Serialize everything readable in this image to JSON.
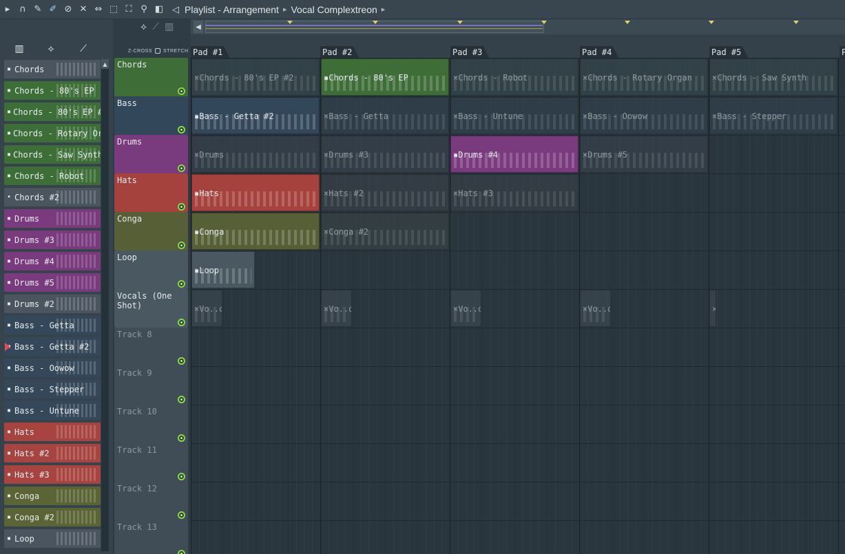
{
  "toolbar": {
    "icons": [
      "play-arrow-icon",
      "magnet-icon",
      "pencil-icon",
      "brush-icon",
      "delete-icon",
      "mute-icon",
      "slip-icon",
      "select-icon",
      "zoom-icon",
      "playback-icon"
    ],
    "breadcrumb": [
      "Playlist - Arrangement",
      "Vocal Complextreon"
    ]
  },
  "browser": {
    "tabs": [
      "piano-icon",
      "wave-icon",
      "automation-icon"
    ],
    "patterns": [
      {
        "label": "Chords",
        "color": "#4a5560",
        "icon": "▪"
      },
      {
        "label": "Chords - 80's EP",
        "color": "#3d6e37",
        "icon": "▪"
      },
      {
        "label": "Chords - 80's EP #2",
        "color": "#3d6e37",
        "icon": "▪"
      },
      {
        "label": "Chords - Rotary Organ",
        "color": "#3d6e37",
        "icon": "▪"
      },
      {
        "label": "Chords - Saw Synth",
        "color": "#3d6e37",
        "icon": "▪"
      },
      {
        "label": "Chords - Robot",
        "color": "#3d6e37",
        "icon": "▪"
      },
      {
        "label": "Chords #2",
        "color": "#4a5560",
        "icon": "•"
      },
      {
        "label": "Drums",
        "color": "#7a3a7e",
        "icon": "▪"
      },
      {
        "label": "Drums #3",
        "color": "#7a3a7e",
        "icon": "▪"
      },
      {
        "label": "Drums #4",
        "color": "#7a3a7e",
        "icon": "▪"
      },
      {
        "label": "Drums #5",
        "color": "#7a3a7e",
        "icon": "▪"
      },
      {
        "label": "Drums #2",
        "color": "#4a5560",
        "icon": "▪"
      },
      {
        "label": "Bass - Getta",
        "color": "#34485a",
        "icon": "▪"
      },
      {
        "label": "Bass - Getta #2",
        "color": "#34485a",
        "icon": "▪"
      },
      {
        "label": "Bass - Oowow",
        "color": "#34485a",
        "icon": "▪"
      },
      {
        "label": "Bass - Stepper",
        "color": "#34485a",
        "icon": "▪"
      },
      {
        "label": "Bass - Untune",
        "color": "#34485a",
        "icon": "▪"
      },
      {
        "label": "Hats",
        "color": "#a8443f",
        "icon": "▪"
      },
      {
        "label": "Hats #2",
        "color": "#a8443f",
        "icon": "▪"
      },
      {
        "label": "Hats #3",
        "color": "#a8443f",
        "icon": "▪"
      },
      {
        "label": "Conga",
        "color": "#5a6434",
        "icon": "▪"
      },
      {
        "label": "Conga #2",
        "color": "#5a6434",
        "icon": "▪"
      },
      {
        "label": "Loop",
        "color": "#4a5560",
        "icon": "▪"
      }
    ]
  },
  "header": {
    "zcross_label": "Z-CROSS",
    "stretch_label": "STRETCH"
  },
  "pads": [
    "Pad #1",
    "Pad #2",
    "Pad #3",
    "Pad #4",
    "Pad #5",
    "P"
  ],
  "tracks": [
    {
      "name": "Chords",
      "color": "#3f6d38"
    },
    {
      "name": "Bass",
      "color": "#33475a"
    },
    {
      "name": "Drums",
      "color": "#7a3a7e"
    },
    {
      "name": "Hats",
      "color": "#a6423d"
    },
    {
      "name": "Conga",
      "color": "#565f36"
    },
    {
      "name": "Loop",
      "color": "#4a5862"
    },
    {
      "name": "Vocals (One Shot)",
      "color": "#4a5862"
    },
    {
      "name": "Track 8",
      "color": ""
    },
    {
      "name": "Track 9",
      "color": ""
    },
    {
      "name": "Track 10",
      "color": ""
    },
    {
      "name": "Track 11",
      "color": ""
    },
    {
      "name": "Track 12",
      "color": ""
    },
    {
      "name": "Track 13",
      "color": ""
    }
  ],
  "clips": [
    {
      "label": "Chords - 80's EP #2",
      "row": 0,
      "pad": 0,
      "span": 1,
      "active": false,
      "color": "#3a4a4f",
      "icon": "×"
    },
    {
      "label": "Chords - 80's EP",
      "row": 0,
      "pad": 1,
      "span": 1,
      "active": true,
      "color": "#3f6d38",
      "icon": "▪"
    },
    {
      "label": "Chords - Robot",
      "row": 0,
      "pad": 2,
      "span": 1,
      "active": false,
      "color": "#3a4a4f",
      "icon": "×"
    },
    {
      "label": "Chords - Rotary Organ",
      "row": 0,
      "pad": 3,
      "span": 1,
      "active": false,
      "color": "#3a4a4f",
      "icon": "×"
    },
    {
      "label": "Chords - Saw Synth",
      "row": 0,
      "pad": 4,
      "span": 1,
      "active": false,
      "color": "#3a4a4f",
      "icon": "×"
    },
    {
      "label": "Bass - Getta #2",
      "row": 1,
      "pad": 0,
      "span": 1,
      "active": true,
      "color": "#33475a",
      "icon": "▪"
    },
    {
      "label": "Bass - Getta",
      "row": 1,
      "pad": 1,
      "span": 1,
      "active": false,
      "color": "#33434f",
      "icon": "×"
    },
    {
      "label": "Bass - Untune",
      "row": 1,
      "pad": 2,
      "span": 1,
      "active": false,
      "color": "#33434f",
      "icon": "×"
    },
    {
      "label": "Bass - Oowow",
      "row": 1,
      "pad": 3,
      "span": 1,
      "active": false,
      "color": "#33434f",
      "icon": "×"
    },
    {
      "label": "Bass - Stepper",
      "row": 1,
      "pad": 4,
      "span": 1,
      "active": false,
      "color": "#33434f",
      "icon": "×"
    },
    {
      "label": "Drums",
      "row": 2,
      "pad": 0,
      "span": 1,
      "active": false,
      "color": "#3a4450",
      "icon": "×"
    },
    {
      "label": "Drums #3",
      "row": 2,
      "pad": 1,
      "span": 1,
      "active": false,
      "color": "#3a4450",
      "icon": "×"
    },
    {
      "label": "Drums #4",
      "row": 2,
      "pad": 2,
      "span": 1,
      "active": true,
      "color": "#7a3a7e",
      "icon": "▪"
    },
    {
      "label": "Drums #5",
      "row": 2,
      "pad": 3,
      "span": 1,
      "active": false,
      "color": "#3a4450",
      "icon": "×"
    },
    {
      "label": "Hats",
      "row": 3,
      "pad": 0,
      "span": 1,
      "active": true,
      "color": "#a6423d",
      "icon": "▪"
    },
    {
      "label": "Hats #2",
      "row": 3,
      "pad": 1,
      "span": 1,
      "active": false,
      "color": "#3c4249",
      "icon": "×"
    },
    {
      "label": "Hats #3",
      "row": 3,
      "pad": 2,
      "span": 1,
      "active": false,
      "color": "#3c4249",
      "icon": "×"
    },
    {
      "label": "Conga",
      "row": 4,
      "pad": 0,
      "span": 1,
      "active": true,
      "color": "#565f36",
      "icon": "▪"
    },
    {
      "label": "Conga #2",
      "row": 4,
      "pad": 1,
      "span": 1,
      "active": false,
      "color": "#3a4547",
      "icon": "×"
    },
    {
      "label": "Loop",
      "row": 5,
      "pad": 0,
      "span": 0.5,
      "active": true,
      "color": "#4a5862",
      "icon": "▪"
    },
    {
      "label": "Vo..on",
      "row": 6,
      "pad": 0,
      "span": 0.25,
      "active": false,
      "color": "#3e4c55",
      "icon": "×"
    },
    {
      "label": "Vo..on",
      "row": 6,
      "pad": 1,
      "span": 0.25,
      "active": false,
      "color": "#3e4c55",
      "icon": "×"
    },
    {
      "label": "Vo..on",
      "row": 6,
      "pad": 2,
      "span": 0.25,
      "active": false,
      "color": "#3e4c55",
      "icon": "×"
    },
    {
      "label": "Vo..on",
      "row": 6,
      "pad": 3,
      "span": 0.25,
      "active": false,
      "color": "#3e4c55",
      "icon": "×"
    },
    {
      "label": "",
      "row": 6,
      "pad": 4,
      "span": 0.06,
      "active": false,
      "color": "#3e4c55",
      "icon": "×"
    }
  ]
}
